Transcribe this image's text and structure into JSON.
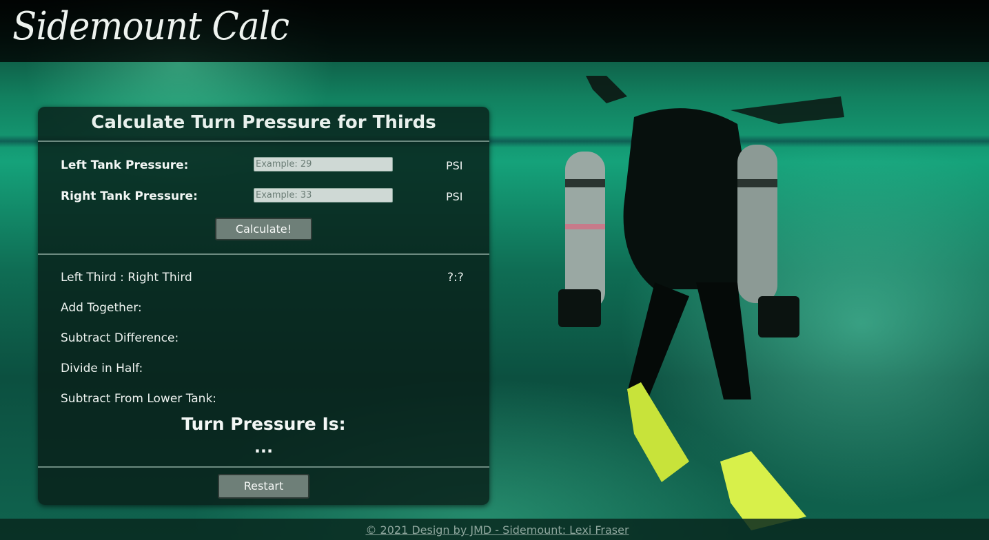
{
  "header": {
    "logo_text": "Sidemount Calc"
  },
  "panel": {
    "title": "Calculate Turn Pressure for Thirds",
    "left_tank": {
      "label": "Left Tank Pressure:",
      "placeholder": "Example: 29",
      "value": "",
      "unit": "PSI"
    },
    "right_tank": {
      "label": "Right Tank Pressure:",
      "placeholder": "Example: 33",
      "value": "",
      "unit": "PSI"
    },
    "calculate_label": "Calculate!",
    "results": {
      "thirds_label": "Left Third : Right Third",
      "thirds_value": "?:?",
      "add_label": "Add Together:",
      "subtract_label": "Subtract Difference:",
      "divide_label": "Divide in Half:",
      "lower_label": "Subtract From Lower Tank:"
    },
    "turn_pressure_title": "Turn Pressure Is:",
    "turn_pressure_value": "...",
    "restart_label": "Restart"
  },
  "footer": {
    "credit_text": "© 2021 Design by JMD - Sidemount: Lexi Fraser"
  },
  "colors": {
    "panel_bg": "#081e18",
    "water_accent": "#15a27a",
    "fin_yellow": "#d8f04a"
  }
}
